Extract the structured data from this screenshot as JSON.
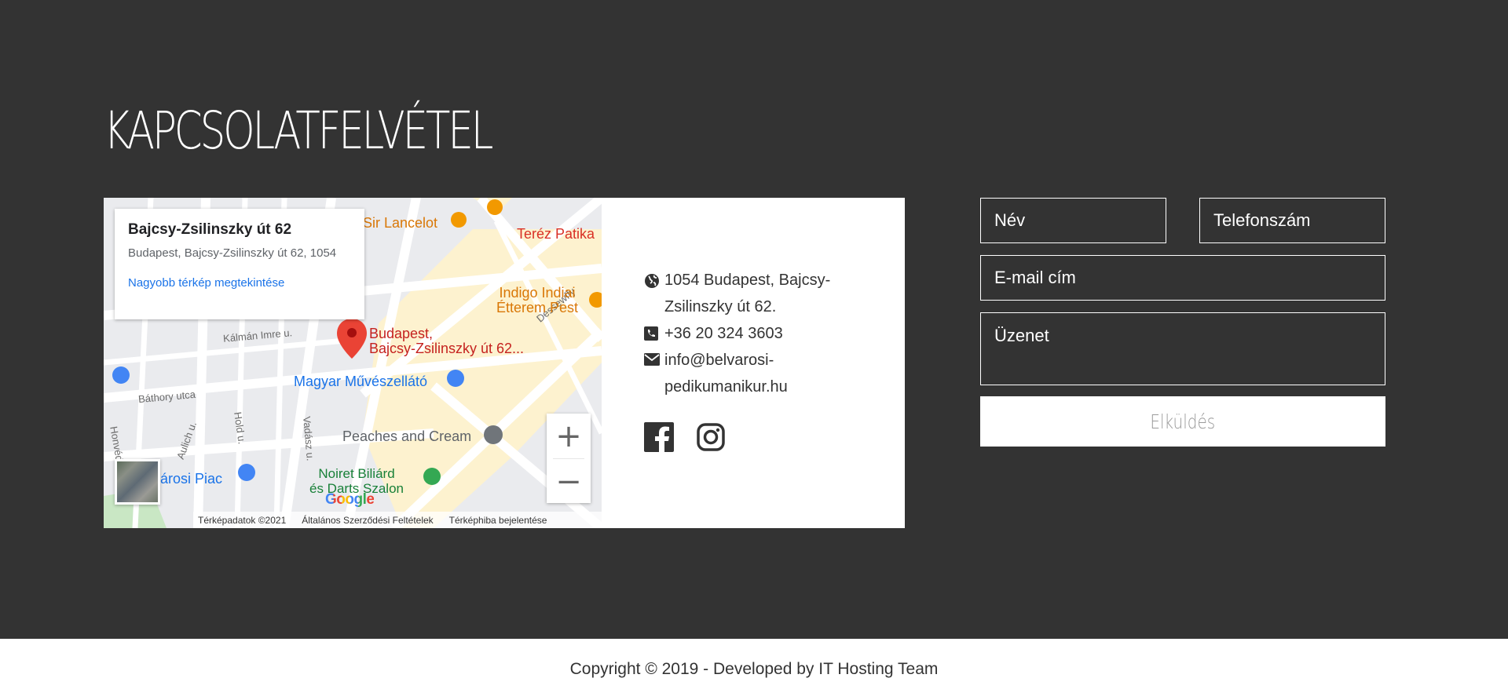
{
  "section": {
    "title": "KAPCSOLATFELVÉTEL"
  },
  "map": {
    "card": {
      "title": "Bajcsy-Zsilinszky út 62",
      "address": "Budapest, Bajcsy-Zsilinszky út 62, 1054",
      "link": "Nagyobb térkép megtekintése"
    },
    "streets": [
      "Kálmán Imre u.",
      "Báthory utca",
      "Honvéd",
      "Aulich u.",
      "Hold u.",
      "Vadász u.",
      "Dessewffy"
    ],
    "pois": {
      "sir_lancelot": "Sir Lancelot",
      "terez_patika": "Teréz Patika",
      "indigo_line1": "Indigo Indiai",
      "indigo_line2": "Étterem Pest",
      "pin_line1": "Budapest,",
      "pin_line2": "Bajcsy-Zsilinszky út 62...",
      "muveszellato": "Magyar Művészellátó",
      "peaches": "Peaches and Cream",
      "noiret_line1": "Noiret Biliárd",
      "noiret_line2": "és Darts Szalon",
      "piac": "árosi Piac"
    },
    "zoom_in": "+",
    "zoom_out": "−",
    "logo": "Google",
    "footer": [
      "Térképadatok ©2021",
      "Általános Szerződési Feltételek",
      "Térképhiba bejelentése"
    ]
  },
  "contact": {
    "address": "1054 Budapest, Bajcsy-Zsilinszky út 62.",
    "phone": "+36 20 324 3603",
    "email": "info@belvarosi-pedikumanikur.hu",
    "icons": [
      "globe-icon",
      "phone-icon",
      "envelope-icon",
      "facebook-icon",
      "instagram-icon"
    ]
  },
  "form": {
    "name_placeholder": "Név",
    "phone_placeholder": "Telefonszám",
    "email_placeholder": "E-mail cím",
    "message_placeholder": "Üzenet",
    "submit_label": "Elküldés"
  },
  "footer": {
    "text": "Copyright © 2019 - Developed by IT Hosting Team"
  },
  "colors": {
    "background": "#333333",
    "panel": "#ffffff",
    "text_dark": "#333333",
    "map_pin": "#ea4335",
    "map_link": "#1a73e8"
  }
}
